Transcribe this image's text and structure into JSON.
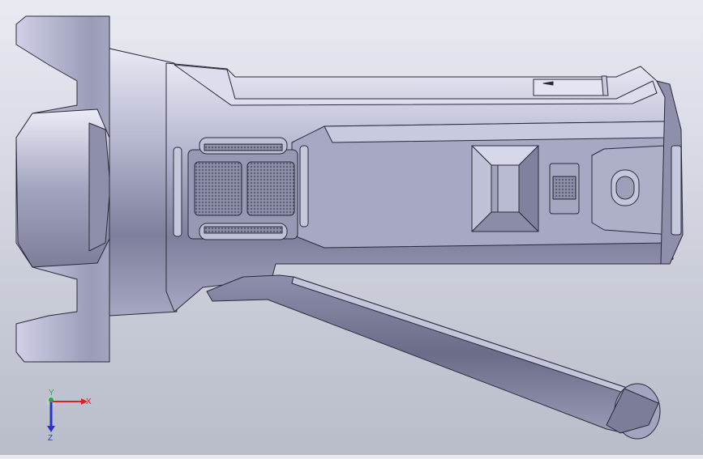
{
  "viewport": {
    "background_top": "#e9ebf2",
    "background_bottom": "#b9bdc9",
    "model_fill": "#b6b8d2",
    "edge_color": "#2a2a3a"
  },
  "triad": {
    "x_label": "X",
    "y_label": "Y",
    "z_label": "Z",
    "x_color": "#d0262b",
    "y_color": "#29a845",
    "z_color": "#2834c8"
  }
}
